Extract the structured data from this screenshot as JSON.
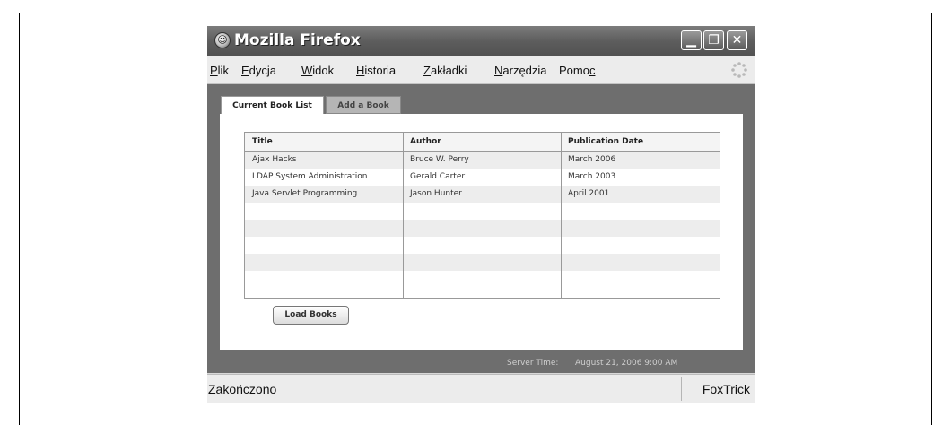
{
  "window": {
    "title": "Mozilla Firefox",
    "controls": {
      "minimize": "▁",
      "restore": "❐",
      "close": "✕"
    }
  },
  "menu": [
    {
      "label": "Plik"
    },
    {
      "label": "Edycja"
    },
    {
      "label": "Widok"
    },
    {
      "label": "Historia"
    },
    {
      "label": "Zakładki"
    },
    {
      "label": "Narzędzia"
    },
    {
      "label": "Pomoc"
    }
  ],
  "tabs": [
    {
      "label": "Current Book List",
      "active": true
    },
    {
      "label": "Add a Book",
      "active": false
    }
  ],
  "table": {
    "headers": [
      "Title",
      "Author",
      "Publication Date"
    ],
    "rows": [
      [
        "Ajax Hacks",
        "Bruce W. Perry",
        "March 2006"
      ],
      [
        "LDAP System Administration",
        "Gerald Carter",
        "March 2003"
      ],
      [
        "Java Servlet Programming",
        "Jason Hunter",
        "April 2001"
      ]
    ]
  },
  "load_button": "Load Books",
  "server_time": {
    "label": "Server Time:",
    "value": "August 21, 2006 9:00 AM"
  },
  "status": {
    "text": "Zakończono",
    "extension": "FoxTrick"
  },
  "icons": {
    "app": "firefox-icon",
    "throbber": "throbber-icon"
  }
}
